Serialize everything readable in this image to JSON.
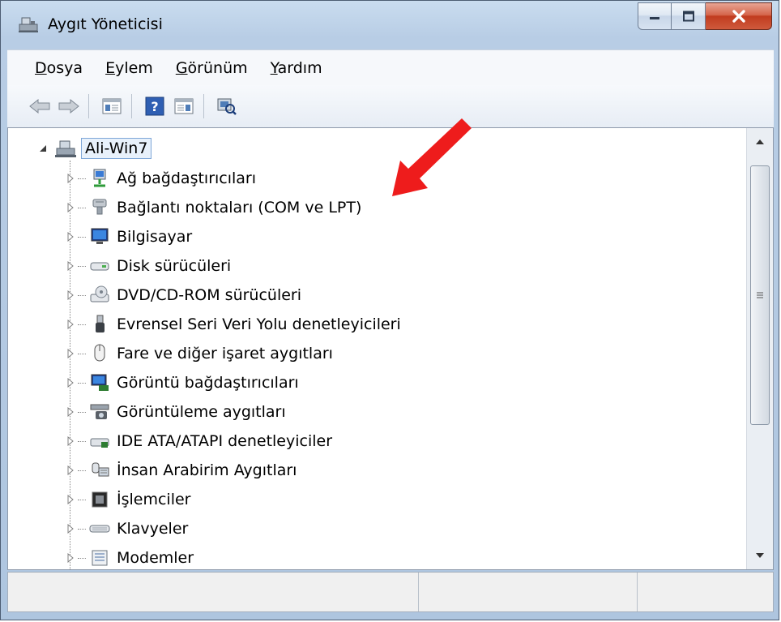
{
  "window": {
    "title": "Aygıt Yöneticisi"
  },
  "menu": [
    {
      "acc": "D",
      "rest": "osya"
    },
    {
      "acc": "E",
      "rest": "ylem"
    },
    {
      "acc": "G",
      "rest": "örünüm"
    },
    {
      "acc": "Y",
      "rest": "ardım"
    }
  ],
  "toolbar": {
    "icons": [
      "back-arrow-icon",
      "forward-arrow-icon",
      "console-tree-icon",
      "help-icon",
      "action-pane-icon",
      "scan-hardware-icon"
    ]
  },
  "tree": {
    "root": "Ali-Win7",
    "items": [
      {
        "label": "Ağ bağdaştırıcıları",
        "icon": "network-adapter-icon"
      },
      {
        "label": "Bağlantı noktaları (COM ve LPT)",
        "icon": "port-icon"
      },
      {
        "label": "Bilgisayar",
        "icon": "computer-icon"
      },
      {
        "label": "Disk sürücüleri",
        "icon": "disk-drive-icon"
      },
      {
        "label": "DVD/CD-ROM sürücüleri",
        "icon": "dvd-drive-icon"
      },
      {
        "label": "Evrensel Seri Veri Yolu denetleyicileri",
        "icon": "usb-icon"
      },
      {
        "label": "Fare ve diğer işaret aygıtları",
        "icon": "mouse-icon"
      },
      {
        "label": "Görüntü bağdaştırıcıları",
        "icon": "display-adapter-icon"
      },
      {
        "label": "Görüntüleme aygıtları",
        "icon": "imaging-device-icon"
      },
      {
        "label": "IDE ATA/ATAPI denetleyiciler",
        "icon": "ide-controller-icon"
      },
      {
        "label": "İnsan Arabirim Aygıtları",
        "icon": "hid-icon"
      },
      {
        "label": "İşlemciler",
        "icon": "processor-icon"
      },
      {
        "label": "Klavyeler",
        "icon": "keyboard-icon"
      },
      {
        "label": "Modemler",
        "icon": "modem-icon"
      }
    ]
  },
  "colors": {
    "accent_arrow": "#ee1c1c",
    "close_button": "#c13b1f"
  }
}
